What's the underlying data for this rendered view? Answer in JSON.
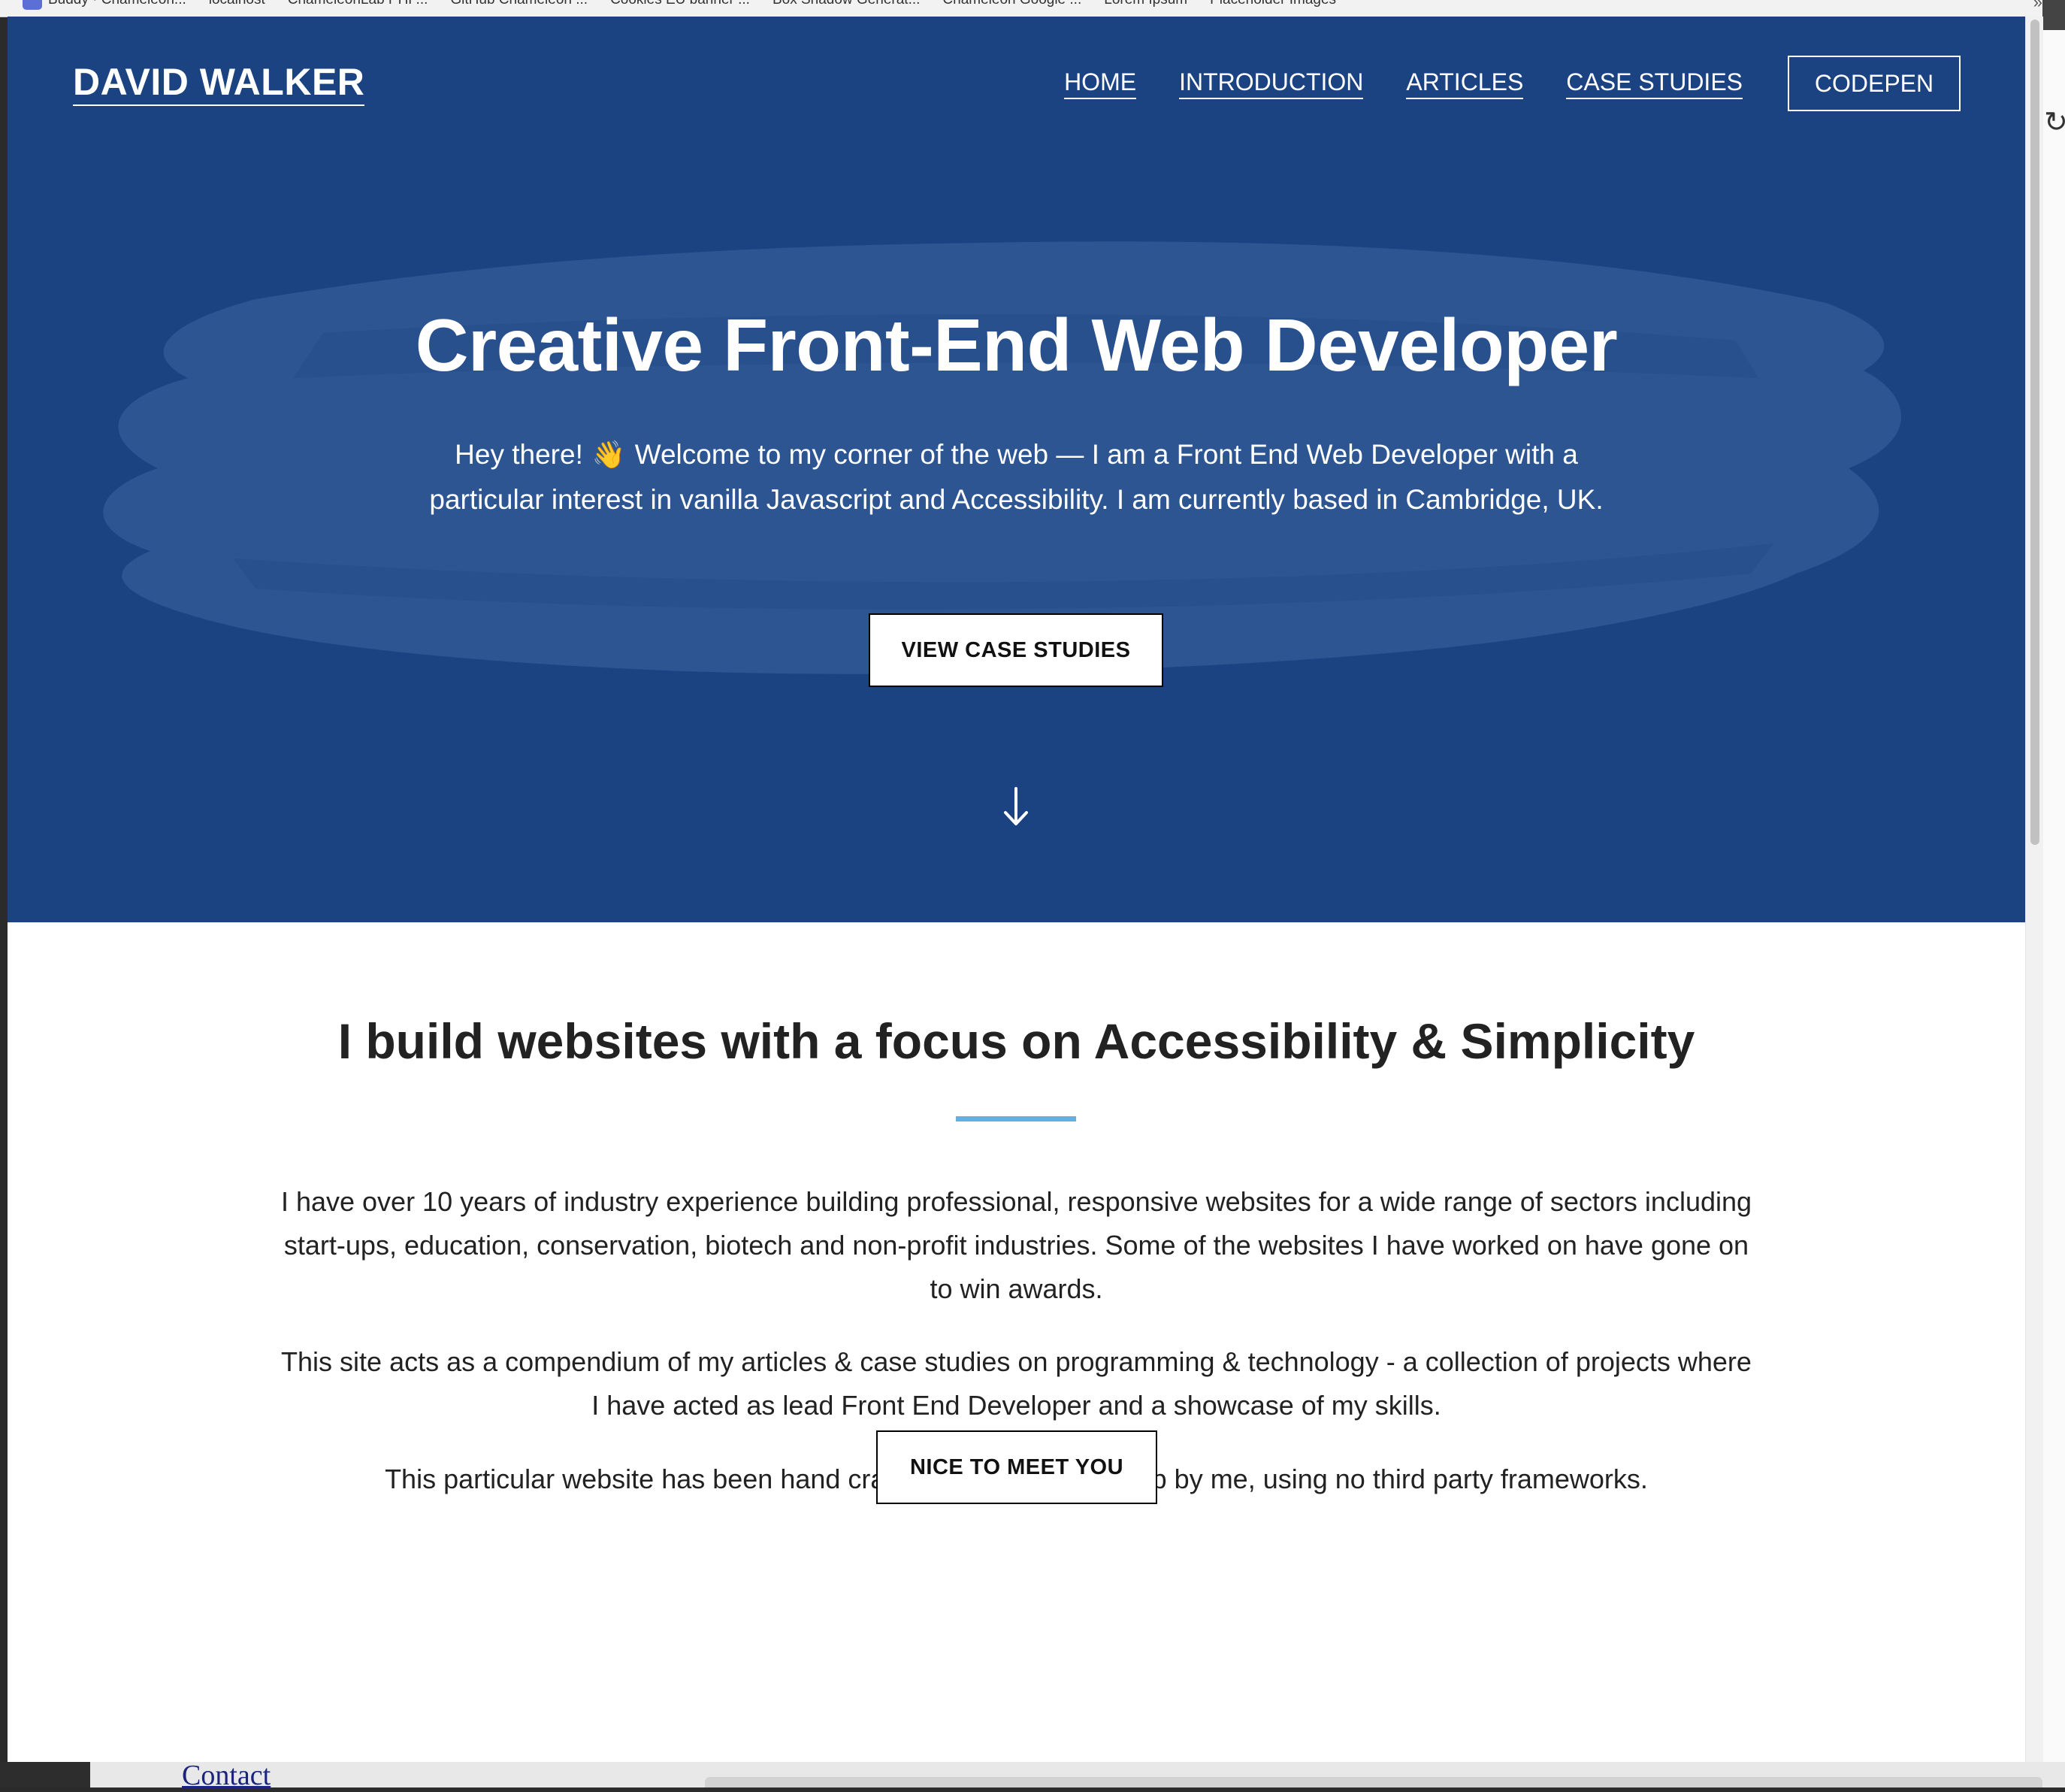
{
  "bookmarks": [
    "Buddy · Chameleon...",
    "localhost",
    "ChameleonLab PHP...",
    "GitHub Chameleon ...",
    "Cookies EU banner ...",
    "Box Shadow Generat...",
    "Chameleon Google ...",
    "Lorem Ipsum",
    "Placeholder Images"
  ],
  "bookmarks_more": "»",
  "header": {
    "logo": "DAVID WALKER",
    "nav": [
      "HOME",
      "INTRODUCTION",
      "ARTICLES",
      "CASE STUDIES"
    ],
    "cta": "CODEPEN"
  },
  "hero": {
    "title": "Creative Front-End Web Developer",
    "text_before_icon": "Hey there!",
    "wave_emoji": "👋",
    "text_after_icon": "Welcome to my corner of the web — I am a Front End Web Developer with a particular interest in vanilla Javascript and Accessibility. I am currently based in Cambridge, UK.",
    "button": "VIEW CASE STUDIES",
    "scroll_icon": "arrow-down-icon"
  },
  "intro": {
    "heading": "I build websites with a focus on Accessibility & Simplicity",
    "paragraphs": [
      "I have over 10 years of industry experience building professional, responsive websites for a wide range of sectors including start-ups, education, conservation, biotech and non-profit industries. Some of the websites I have worked on have gone on to win awards.",
      "This site acts as a compendium of my articles & case studies on programming & technology - a collection of projects where I have acted as lead Front End Developer and a showcase of my skills.",
      "This particular website has been hand crafted from the ground up by me, using no third party frameworks."
    ],
    "button": "NICE TO MEET YOU"
  },
  "background_window": {
    "link": "Contact"
  },
  "colors": {
    "header_bg": "#1c4381",
    "brush": "#2c5592",
    "accent_rule": "#5eb0e5",
    "text_dark": "#222222"
  }
}
